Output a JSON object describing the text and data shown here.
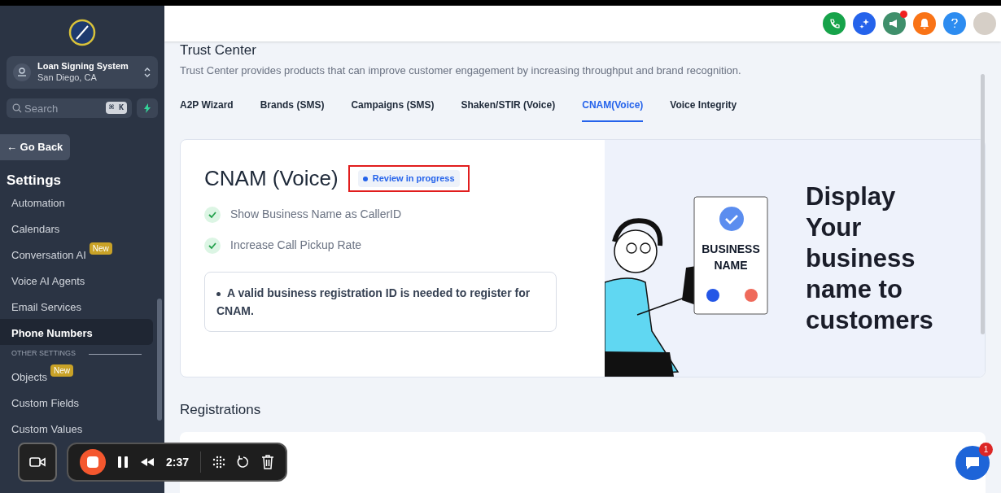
{
  "sidebar": {
    "account": {
      "name": "Loan Signing System",
      "location": "San Diego, CA"
    },
    "search": {
      "placeholder": "Search",
      "shortcut": "⌘ K"
    },
    "back": "← Go Back",
    "heading": "Settings",
    "items": [
      {
        "kind": "item",
        "label": "Automation",
        "selected": false
      },
      {
        "kind": "item",
        "label": "Calendars",
        "selected": false
      },
      {
        "kind": "item",
        "label": "Conversation AI",
        "badge": "New",
        "selected": false
      },
      {
        "kind": "item",
        "label": "Voice AI Agents",
        "selected": false
      },
      {
        "kind": "item",
        "label": "Email Services",
        "selected": false
      },
      {
        "kind": "item",
        "label": "Phone Numbers",
        "selected": true
      },
      {
        "kind": "section",
        "label": "OTHER SETTINGS"
      },
      {
        "kind": "item",
        "label": "Objects",
        "badge": "New",
        "selected": false
      },
      {
        "kind": "item",
        "label": "Custom Fields",
        "selected": false
      },
      {
        "kind": "item",
        "label": "Custom Values",
        "selected": false
      }
    ]
  },
  "page": {
    "title": "Trust Center",
    "subtitle": "Trust Center provides products that can improve customer engagement by increasing throughput and brand recognition.",
    "tabs": [
      {
        "label": "A2P Wizard",
        "selected": false
      },
      {
        "label": "Brands (SMS)",
        "selected": false
      },
      {
        "label": "Campaigns (SMS)",
        "selected": false
      },
      {
        "label": "Shaken/STIR (Voice)",
        "selected": false
      },
      {
        "label": "CNAM(Voice)",
        "selected": true
      },
      {
        "label": "Voice Integrity",
        "selected": false
      }
    ]
  },
  "card": {
    "title": "CNAM (Voice)",
    "status": "Review in progress",
    "features": [
      "Show Business Name as CallerID",
      "Increase Call Pickup Rate"
    ],
    "note": "A valid business registration ID is needed to register for CNAM.",
    "illustration": {
      "phone_label": "BUSINESS NAME"
    },
    "headline": "Display Your business name to customers"
  },
  "registrations": {
    "title": "Registrations"
  },
  "recorder": {
    "time": "2:37"
  },
  "chat": {
    "badge": "1"
  }
}
